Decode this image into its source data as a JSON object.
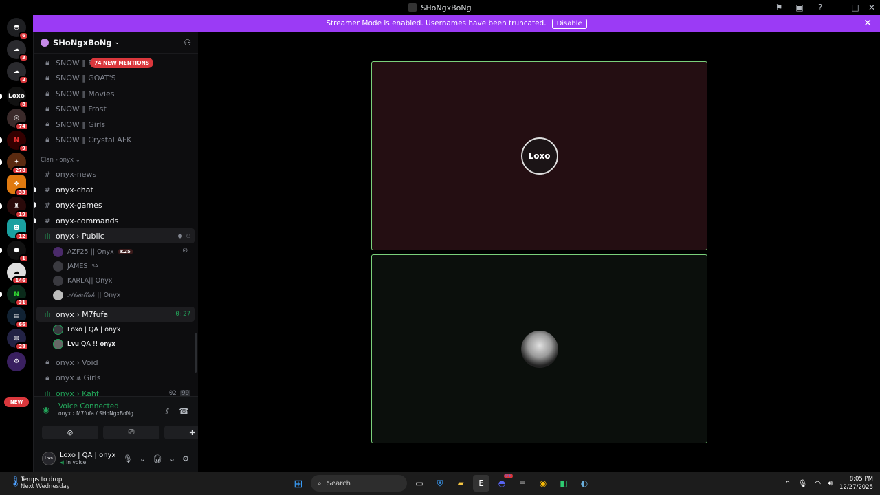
{
  "window": {
    "title": "SHoNgxBoNg"
  },
  "banner": {
    "text": "Streamer Mode is enabled. Usernames have been truncated.",
    "disable_label": "Disable"
  },
  "server": {
    "name": "SHoNgxBoNg"
  },
  "mentions_pill": "74 NEW MENTIONS",
  "guild_badges": [
    "6",
    "3",
    "2",
    "8",
    "74",
    "9",
    "278",
    "33",
    "19",
    "12",
    "1",
    "146",
    "31",
    "66",
    "28"
  ],
  "guild_loxo_label": "Loxo",
  "guild_new": "NEW",
  "channels_locked": [
    "SNOW ‖ Bl",
    "SNOW ‖ GOAT'S",
    "SNOW ‖ Movies",
    "SNOW ‖ Frost",
    "SNOW ‖ Girls",
    "SNOW ‖ Crystal AFK"
  ],
  "category": "Clan - onyx",
  "text_channels": [
    "onyx-news",
    "onyx-chat",
    "onyx-games",
    "onyx-commands"
  ],
  "voice_public": {
    "name": "onyx › Public",
    "users": [
      {
        "name": "AZF25 || Onyx",
        "tag": "K25"
      },
      {
        "name": "JAMES",
        "suffix": "SA"
      },
      {
        "name": "KARLA|| Onyx"
      },
      {
        "name": "𝒜𝒷𝒹𝓊𝓁𝓁𝒶𝒽 || Onyx"
      }
    ]
  },
  "voice_m7fufa": {
    "name": "onyx › M7fufa",
    "timer": "0:27",
    "users": [
      {
        "name": "Loxo | QA | onyx"
      },
      {
        "name": "𝐋𝐯𝐮 QA !! 𝐨𝐧𝐲𝐱"
      }
    ]
  },
  "voice_void": "onyx › Void",
  "voice_girls": "onyx ⨳ Girls",
  "voice_kahf": {
    "name": "onyx › Kahf",
    "count_a": "02",
    "count_b": "99"
  },
  "voice_panel": {
    "status": "Voice Connected",
    "location": "onyx › M7fufa / SHoNgxBoNg"
  },
  "user_panel": {
    "name": "Loxo | QA | onyx",
    "status": "In voice",
    "avatar_text": "Loxo"
  },
  "stage": {
    "tile1_avatar": "Loxo"
  },
  "taskbar": {
    "weather_line1": "Temps to drop",
    "weather_line2": "Next Wednesday",
    "search_placeholder": "Search",
    "time": "8:05 PM",
    "date": "12/27/2025",
    "discord_badge": "9+"
  }
}
